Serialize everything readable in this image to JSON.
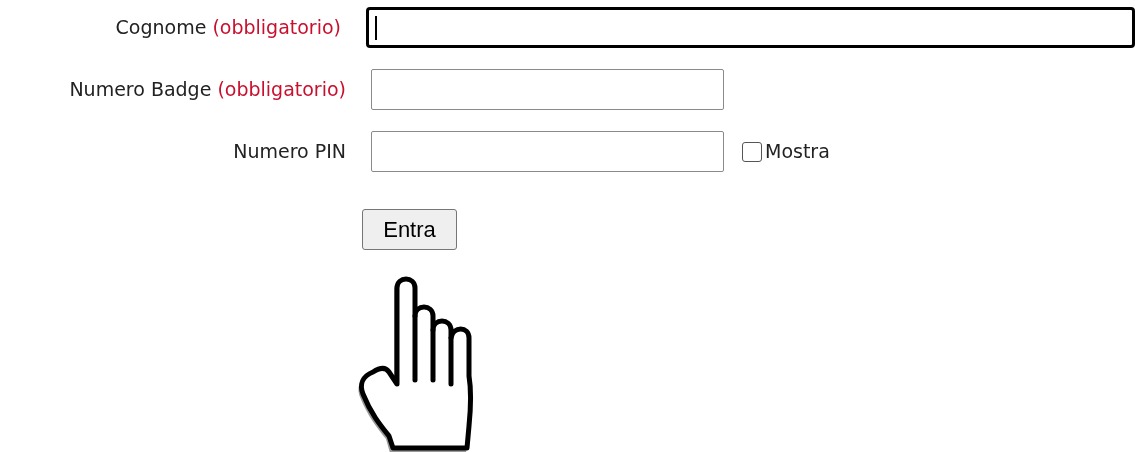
{
  "fields": [
    {
      "label": "Cognome",
      "required_note": "(obbligatorio)",
      "focused": true
    },
    {
      "label": "Numero Badge",
      "required_note": "(obbligatorio)",
      "focused": false
    },
    {
      "label": "Numero PIN",
      "focused": false,
      "toggle": {
        "label": "Mostra",
        "checked": false
      }
    }
  ],
  "submit_button": "Entra"
}
